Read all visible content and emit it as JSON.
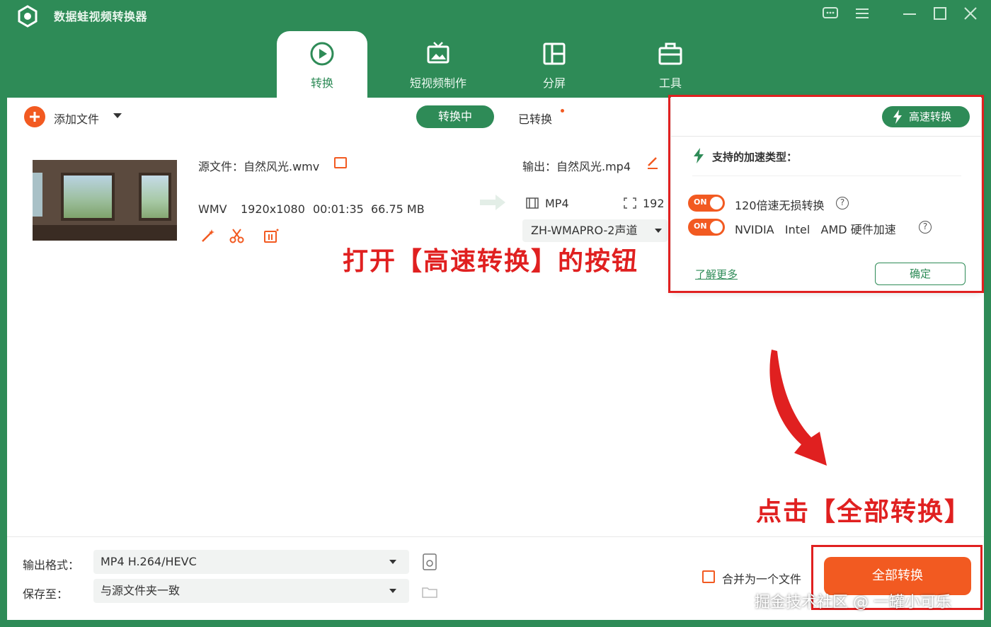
{
  "app": {
    "title": "数据蛙视频转换器"
  },
  "tabs": [
    {
      "label": "转换",
      "icon": "convert-icon",
      "active": true
    },
    {
      "label": "短视频制作",
      "icon": "tv-icon",
      "active": false
    },
    {
      "label": "分屏",
      "icon": "split-screen-icon",
      "active": false
    },
    {
      "label": "工具",
      "icon": "toolbox-icon",
      "active": false
    }
  ],
  "toolbar": {
    "add_file_label": "添加文件",
    "status_tabs": [
      "转换中",
      "已转换"
    ]
  },
  "file": {
    "source_label": "源文件：自然风光.wmv",
    "format": "WMV",
    "resolution": "1920x1080",
    "duration": "00:01:35",
    "size": "66.75 MB",
    "output_label": "输出：自然风光.mp4",
    "output_format": "MP4",
    "output_resolution": "192",
    "audio_track": "ZH-WMAPRO-2声道"
  },
  "annotations": {
    "open_turbo": "打开【高速转换】的按钮",
    "click_convert_all": "点击【全部转换】"
  },
  "popup": {
    "turbo_button": "高速转换",
    "title": "支持的加速类型：",
    "options": [
      {
        "toggle": "ON",
        "text": "120倍速无损转换"
      },
      {
        "toggle": "ON",
        "text": "NVIDIA   Intel   AMD 硬件加速"
      }
    ],
    "learn_more": "了解更多",
    "confirm": "确定"
  },
  "bottom": {
    "output_format_label": "输出格式：",
    "output_format_value": "MP4 H.264/HEVC",
    "save_to_label": "保存至：",
    "save_to_value": "与源文件夹一致",
    "merge_label": "合并为一个文件",
    "convert_all": "全部转换"
  },
  "watermark": "掘金技术社区 @ 一罐小可乐",
  "colors": {
    "brand_green": "#2e8b57",
    "accent_orange": "#f25a21",
    "annotation_red": "#e02020"
  }
}
